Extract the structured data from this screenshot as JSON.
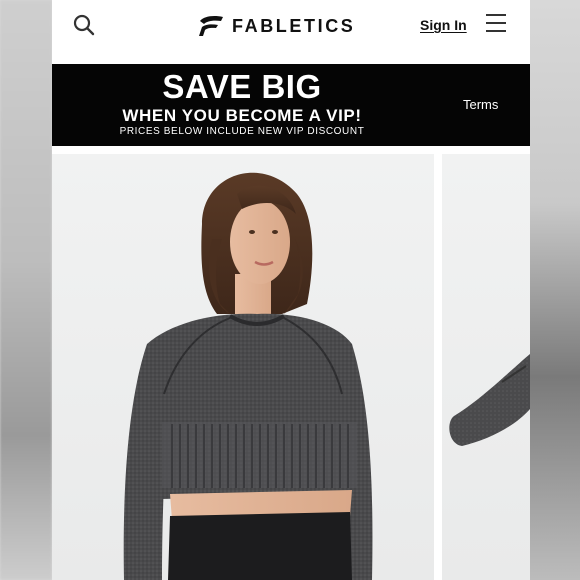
{
  "header": {
    "search_icon": "search-icon",
    "brand": "FABLETICS",
    "sign_in": "Sign In",
    "menu_icon": "hamburger-menu-icon"
  },
  "promo": {
    "headline": "SAVE BIG",
    "subheadline": "WHEN YOU BECOME A VIP!",
    "note": "PRICES BELOW INCLUDE NEW VIP DISCOUNT",
    "terms": "Terms",
    "background": "#050505",
    "text_color": "#ffffff"
  },
  "gallery": {
    "images": [
      "product-photo-front",
      "product-photo-next"
    ]
  }
}
